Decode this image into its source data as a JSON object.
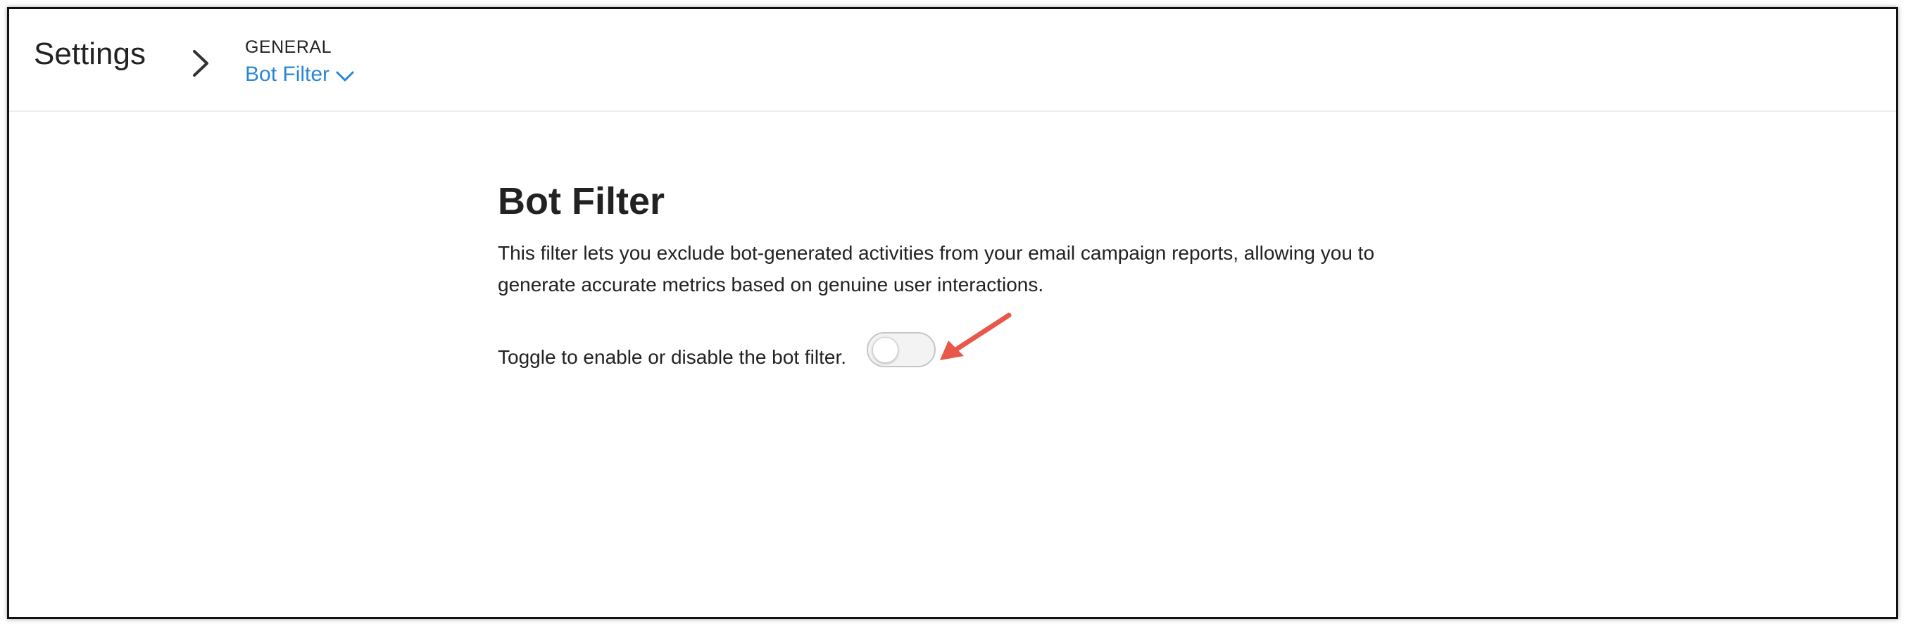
{
  "header": {
    "title": "Settings",
    "breadcrumb_group": "GENERAL",
    "breadcrumb_current": "Bot Filter"
  },
  "main": {
    "title": "Bot Filter",
    "description": "This filter lets you exclude bot-generated activities from your email campaign reports, allowing you to generate accurate metrics based on genuine user interactions.",
    "toggle_label": "Toggle to enable or disable the bot filter.",
    "toggle_enabled": false
  },
  "icons": {
    "breadcrumb_separator": "chevron-right-icon",
    "dropdown_caret": "chevron-down-icon",
    "annotation": "red-arrow-annotation"
  },
  "colors": {
    "link": "#2a86d4",
    "text": "#222222",
    "annotation": "#e8574a",
    "toggle_off": "#f3f3f3"
  }
}
